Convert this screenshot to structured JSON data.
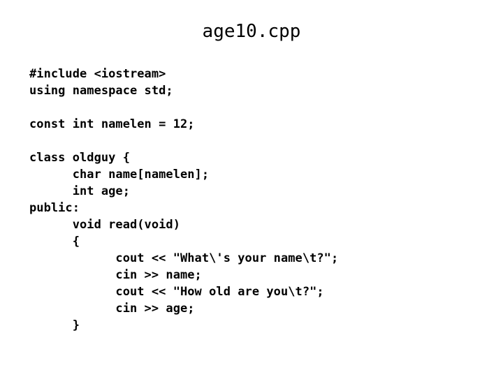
{
  "slide": {
    "title": "age10.cpp",
    "background_color": "#ffffff",
    "text_color": "#000000"
  },
  "code": {
    "language": "cpp",
    "lines": [
      "#include <iostream>",
      "using namespace std;",
      "",
      "const int namelen = 12;",
      "",
      "class oldguy {",
      "      char name[namelen];",
      "      int age;",
      "public:",
      "      void read(void)",
      "      {",
      "            cout << \"What\\'s your name\\t?\";",
      "            cin >> name;",
      "            cout << \"How old are you\\t?\";",
      "            cin >> age;",
      "      }"
    ]
  }
}
